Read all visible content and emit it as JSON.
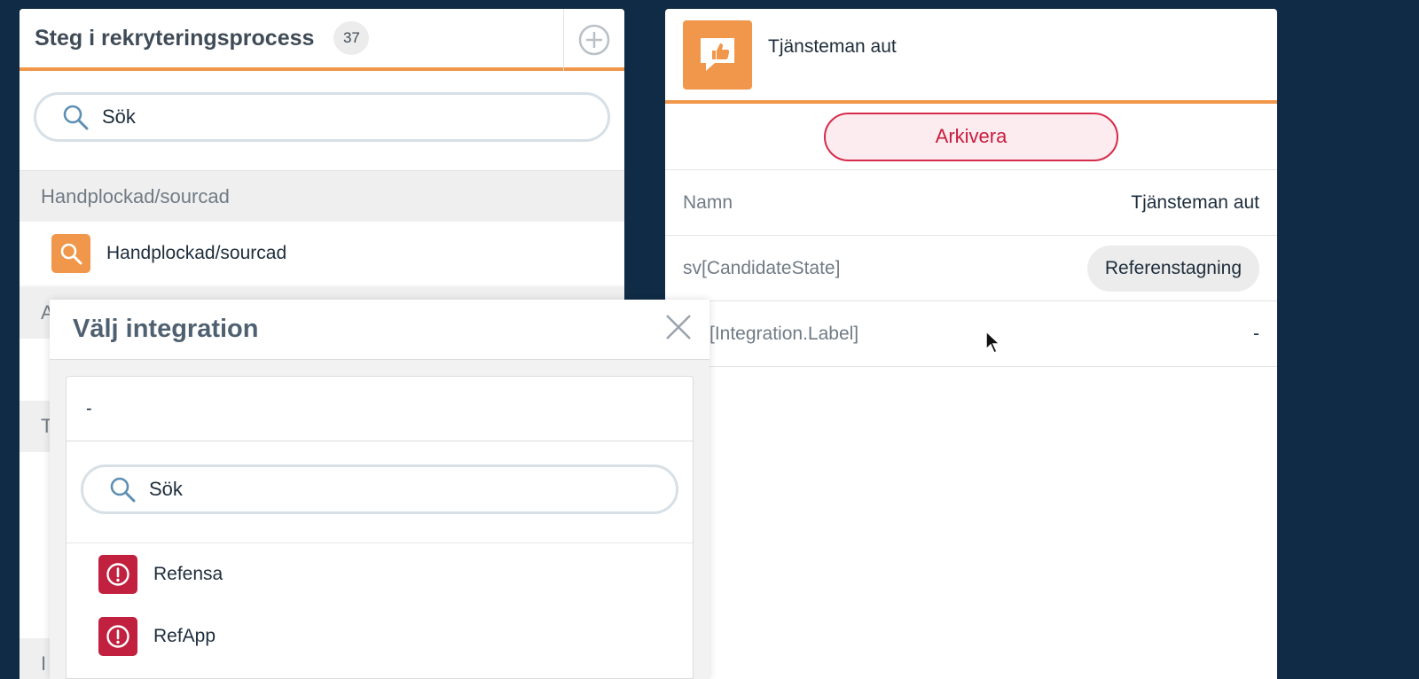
{
  "left_panel": {
    "title": "Steg i rekryteringsprocess",
    "count": "37",
    "add_icon": "plus-circle-icon",
    "search_placeholder": "Sök",
    "group_header": "Handplockad/sourcad",
    "item_label": "Handplockad/sourcad",
    "item_icon": "search-icon",
    "partial_groups": [
      "A",
      "T",
      "I"
    ]
  },
  "right_panel": {
    "title": "Tjänsteman aut",
    "icon": "thumbs-up-chat-icon",
    "archive_label": "Arkivera",
    "properties": [
      {
        "key": "Namn",
        "value": "Tjänsteman aut"
      },
      {
        "key": "sv[CandidateState]",
        "value": "Referenstagning"
      },
      {
        "key": "[Integration.Label]",
        "value": "-"
      }
    ]
  },
  "modal": {
    "title": "Välj integration",
    "close_icon": "close-icon",
    "none_option": "-",
    "search_placeholder": "Sök",
    "items": [
      {
        "label": "Refensa",
        "icon": "alert-icon"
      },
      {
        "label": "RefApp",
        "icon": "alert-icon"
      }
    ]
  },
  "colors": {
    "accent": "#f0974b",
    "danger": "#c1203f",
    "background": "#0f2b45"
  }
}
